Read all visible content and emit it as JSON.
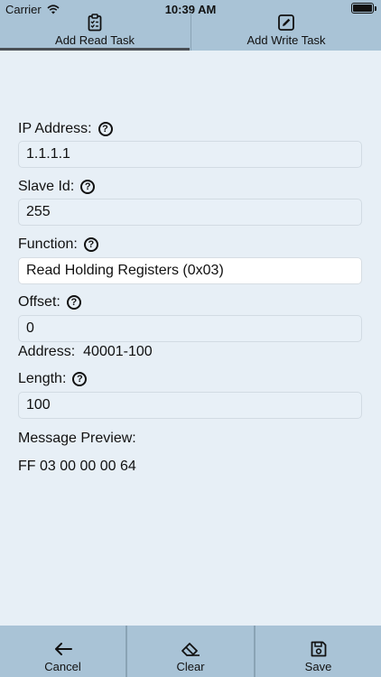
{
  "status_bar": {
    "carrier": "Carrier",
    "time": "10:39 AM"
  },
  "tabs": [
    {
      "label": "Add Read Task",
      "icon": "clipboard-check-icon",
      "selected": true
    },
    {
      "label": "Add Write Task",
      "icon": "edit-square-icon",
      "selected": false
    }
  ],
  "form": {
    "ip_address": {
      "label": "IP Address:",
      "value": "1.1.1.1"
    },
    "slave_id": {
      "label": "Slave Id:",
      "value": "255"
    },
    "function": {
      "label": "Function:",
      "value": "Read Holding Registers (0x03)"
    },
    "offset": {
      "label": "Offset:",
      "value": "0"
    },
    "address": {
      "label": "Address:",
      "value": "40001-100"
    },
    "length": {
      "label": "Length:",
      "value": "100"
    },
    "message_preview": {
      "label": "Message Preview:",
      "value": "FF 03 00 00 00 64"
    },
    "help_glyph": "?"
  },
  "toolbar": {
    "cancel": {
      "label": "Cancel",
      "icon": "arrow-left-icon"
    },
    "clear": {
      "label": "Clear",
      "icon": "eraser-icon"
    },
    "save": {
      "label": "Save",
      "icon": "floppy-disk-icon"
    }
  },
  "colors": {
    "bar": "#a9c3d6",
    "background": "#e7eff6",
    "field": "#e8f0f7",
    "selected_field": "#ffffff"
  }
}
